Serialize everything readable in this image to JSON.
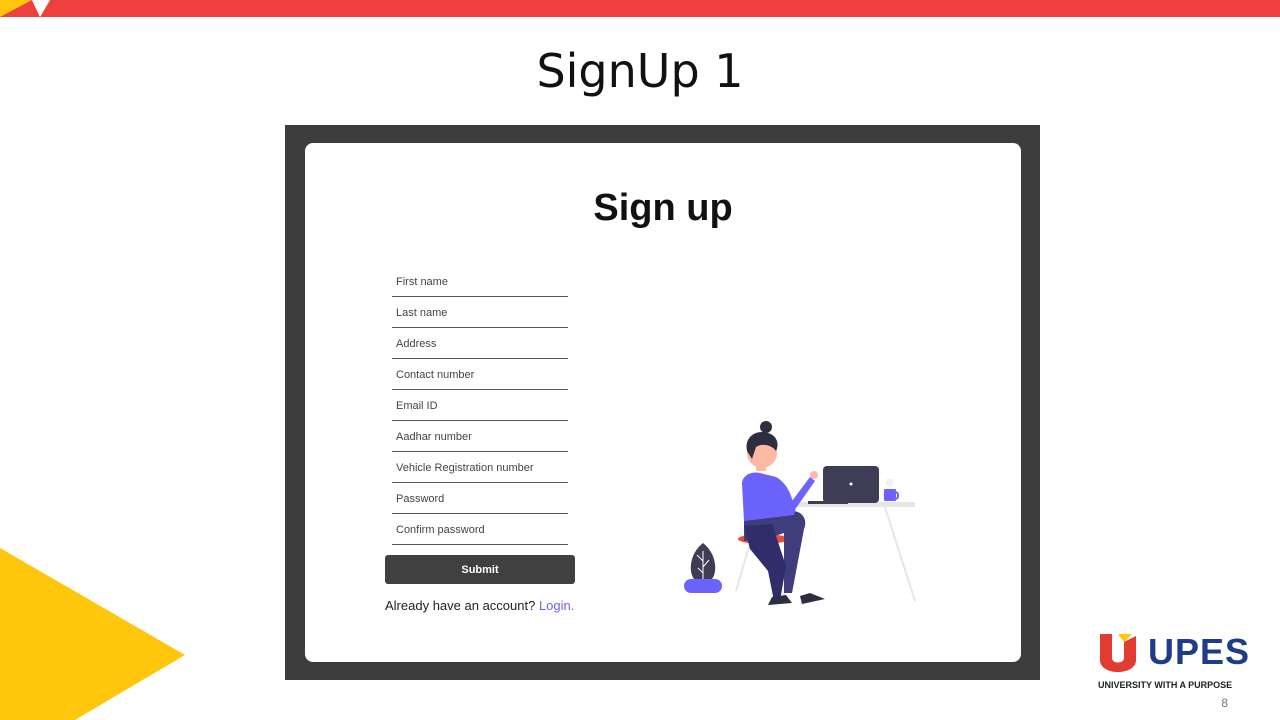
{
  "slide": {
    "title": "SignUp 1",
    "page_number": "8",
    "colors": {
      "top_bar": "#ef4040",
      "accent_yellow": "#ffc60b",
      "brand_blue": "#1f3c88"
    }
  },
  "signup": {
    "heading": "Sign up",
    "fields": {
      "first_name": "First name",
      "last_name": "Last name",
      "address": "Address",
      "contact_number": "Contact number",
      "email_id": "Email ID",
      "aadhar_number": "Aadhar number",
      "vehicle_registration": "Vehicle Registration number",
      "password": "Password",
      "confirm_password": "Confirm password"
    },
    "submit_label": "Submit",
    "login_prompt": "Already have an account?",
    "login_link": "Login.",
    "colors": {
      "button": "#404040",
      "link": "#6c63ff",
      "frame": "#3d3d3d"
    }
  },
  "logo": {
    "text": "UPES",
    "tagline": "UNIVERSITY WITH A PURPOSE"
  },
  "illustration": {
    "icon": "person-at-desk-illustration"
  }
}
